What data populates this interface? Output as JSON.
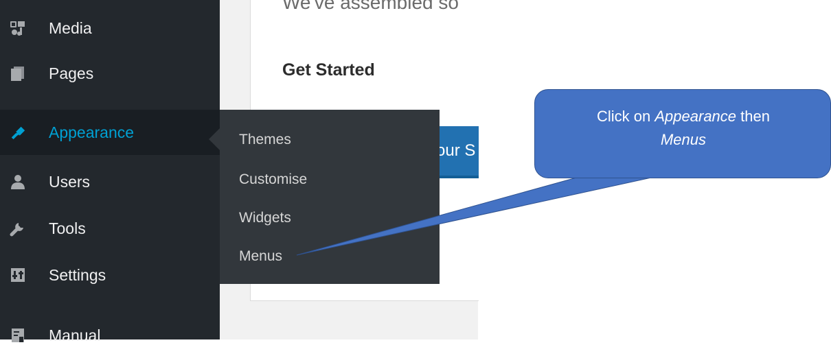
{
  "sidebar": {
    "items": [
      {
        "label": "Media",
        "icon": "media-icon"
      },
      {
        "label": "Pages",
        "icon": "pages-icon"
      },
      {
        "label": "Appearance",
        "icon": "appearance-icon",
        "active": true
      },
      {
        "label": "Users",
        "icon": "users-icon"
      },
      {
        "label": "Tools",
        "icon": "tools-icon"
      },
      {
        "label": "Settings",
        "icon": "settings-icon"
      },
      {
        "label": "Manual",
        "icon": "manual-icon"
      }
    ]
  },
  "submenu": {
    "items": [
      "Themes",
      "Customise",
      "Widgets",
      "Menus"
    ]
  },
  "content": {
    "partial_text": "We've assembled so",
    "heading": "Get Started",
    "button_partial": "our S"
  },
  "callout": {
    "prefix": "Click on ",
    "emph1": "Appearance",
    "middle": " then",
    "emph2": "Menus"
  },
  "colors": {
    "sidebar_bg": "#23282d",
    "submenu_bg": "#32373c",
    "active_label": "#00a0d2",
    "button_blue": "#2271b1",
    "callout_blue": "#4472c4"
  }
}
